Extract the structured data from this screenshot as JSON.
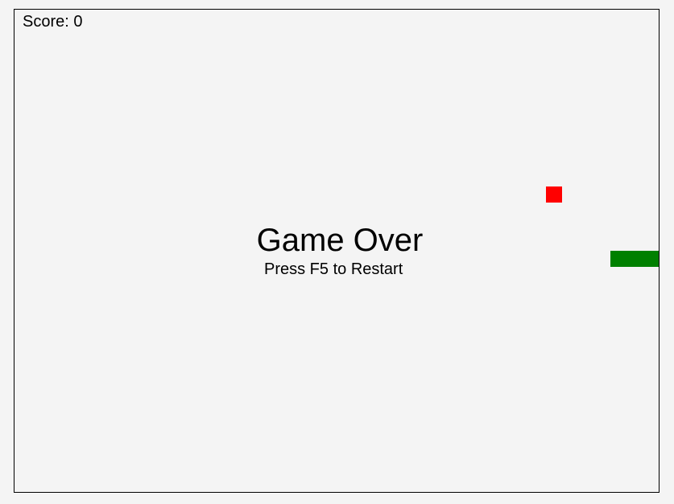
{
  "hud": {
    "score_label": "Score: 0",
    "score_value": 0
  },
  "overlay": {
    "title": "Game Over",
    "hint": "Press F5 to Restart"
  },
  "grid": {
    "cell_units": 20,
    "cols": 40,
    "rows": 30
  },
  "food": {
    "col": 33,
    "row": 11,
    "color": "#ff0000"
  },
  "snake": {
    "color": "#008000",
    "segments": [
      {
        "col": 37,
        "row": 15
      },
      {
        "col": 38,
        "row": 15
      },
      {
        "col": 39,
        "row": 15
      }
    ]
  }
}
